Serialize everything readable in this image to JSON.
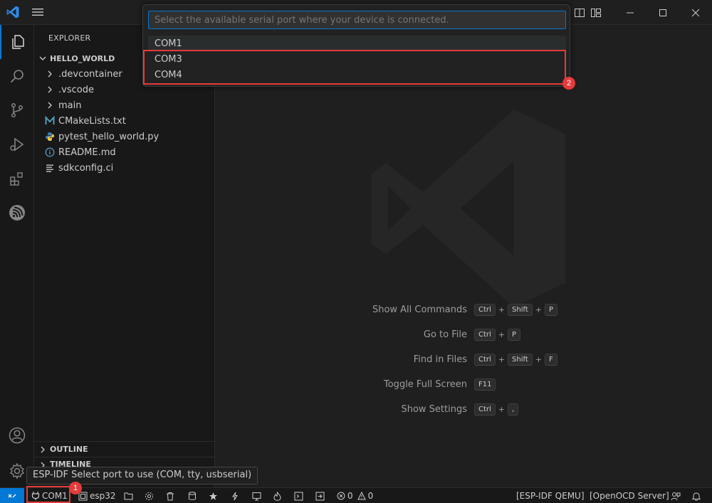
{
  "titlebar": {
    "logo_icon": "vscode-logo-icon",
    "menu_icon": "hamburger-menu-icon",
    "layout_icons": [
      "toggle-primary-sidebar-icon",
      "toggle-panel-icon",
      "toggle-secondary-sidebar-icon",
      "customize-layout-icon"
    ],
    "window_controls": [
      "minimize-icon",
      "maximize-icon",
      "close-icon"
    ]
  },
  "activity_bar": {
    "items": [
      "explorer-icon",
      "search-icon",
      "source-control-icon",
      "run-debug-icon",
      "extensions-icon",
      "espressif-icon"
    ],
    "bottom_items": [
      "accounts-icon",
      "manage-gear-icon"
    ]
  },
  "sidebar": {
    "title": "EXPLORER",
    "folder": "HELLO_WORLD",
    "tree": [
      {
        "label": ".devcontainer",
        "type": "folder"
      },
      {
        "label": ".vscode",
        "type": "folder"
      },
      {
        "label": "main",
        "type": "folder"
      },
      {
        "label": "CMakeLists.txt",
        "type": "file",
        "icon": "M"
      },
      {
        "label": "pytest_hello_world.py",
        "type": "file",
        "icon": "python"
      },
      {
        "label": "README.md",
        "type": "file",
        "icon": "info"
      },
      {
        "label": "sdkconfig.ci",
        "type": "file",
        "icon": "lines"
      }
    ],
    "outline": "OUTLINE",
    "timeline": "TIMELINE"
  },
  "quick_pick": {
    "placeholder": "Select the available serial port where your device is connected.",
    "items": [
      "COM1",
      "COM3",
      "COM4"
    ],
    "selected_index": 0,
    "callout_number": "2"
  },
  "editor": {
    "shortcuts": [
      {
        "label": "Show All Commands",
        "keys": [
          "Ctrl",
          "Shift",
          "P"
        ]
      },
      {
        "label": "Go to File",
        "keys": [
          "Ctrl",
          "P"
        ]
      },
      {
        "label": "Find in Files",
        "keys": [
          "Ctrl",
          "Shift",
          "F"
        ]
      },
      {
        "label": "Toggle Full Screen",
        "keys": [
          "F11"
        ]
      },
      {
        "label": "Show Settings",
        "keys": [
          "Ctrl",
          ","
        ]
      }
    ]
  },
  "tooltip": {
    "text": "ESP-IDF Select port to use (COM, tty, usbserial)"
  },
  "statusbar": {
    "port": "COM1",
    "port_callout_number": "1",
    "target": "esp32",
    "problems_errors": "0",
    "problems_warnings": "0",
    "qemu": "[ESP-IDF QEMU]",
    "openocd": "[OpenOCD Server]"
  },
  "colors": {
    "accent": "#0078d4",
    "highlight_red": "#e53b3b",
    "background": "#1f1f1f",
    "sidebar_background": "#181818"
  }
}
